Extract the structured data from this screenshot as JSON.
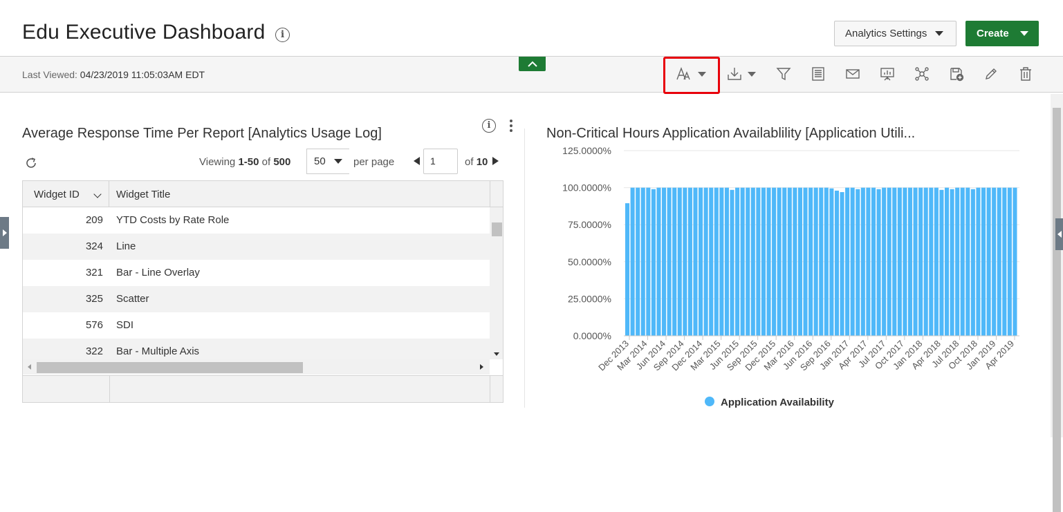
{
  "header": {
    "title": "Edu Executive Dashboard",
    "info_icon": "info-icon",
    "settings_label": "Analytics Settings",
    "create_label": "Create",
    "create_color": "#1e7b34"
  },
  "toolbar": {
    "last_viewed_label": "Last Viewed:",
    "last_viewed_value": "04/23/2019 11:05:03AM EDT",
    "icons": [
      "font-size-icon",
      "download-icon",
      "filter-icon",
      "notes-icon",
      "email-icon",
      "presentation-icon",
      "network-icon",
      "save-as-icon",
      "edit-icon",
      "delete-icon"
    ]
  },
  "left_widget": {
    "title": "Average Response Time Per Report [Analytics Usage Log]",
    "viewing_label": "Viewing",
    "viewing_range": "1-50",
    "of_label": "of",
    "total": "500",
    "page_size": "50",
    "per_page_label": "per page",
    "page_input": "1",
    "page_of_label": "of",
    "page_total": "10",
    "columns": [
      "Widget ID",
      "Widget Title"
    ],
    "rows": [
      {
        "id": "209",
        "title": "YTD Costs by Rate Role"
      },
      {
        "id": "324",
        "title": "Line"
      },
      {
        "id": "321",
        "title": "Bar - Line Overlay"
      },
      {
        "id": "325",
        "title": "Scatter"
      },
      {
        "id": "576",
        "title": "SDI"
      },
      {
        "id": "322",
        "title": "Bar - Multiple Axis"
      }
    ]
  },
  "right_widget": {
    "title": "Non-Critical Hours Application Availablility [Application Utili..."
  },
  "chart_data": {
    "type": "bar",
    "title": "Non-Critical Hours Application Availablility [Application Utili...",
    "color": "#4fb8f9",
    "y_ticks": [
      "0.0000%",
      "25.0000%",
      "50.0000%",
      "75.0000%",
      "100.0000%",
      "125.0000%"
    ],
    "ylim": [
      0,
      125
    ],
    "tick_labels": [
      "Dec 2013",
      "Mar 2014",
      "Jun 2014",
      "Sep 2014",
      "Dec 2014",
      "Mar 2015",
      "Jun 2015",
      "Sep 2015",
      "Dec 2015",
      "Mar 2016",
      "Jun 2016",
      "Sep 2016",
      "Jan 2017",
      "Apr 2017",
      "Jul 2017",
      "Oct 2017",
      "Jan 2018",
      "Apr 2018",
      "Jul 2018",
      "Oct 2018",
      "Jan 2019",
      "Apr 2019"
    ],
    "series": [
      {
        "name": "Application Availability",
        "values": [
          89.5,
          100,
          100,
          100,
          100,
          99,
          100,
          100,
          100,
          100,
          100,
          100,
          100,
          100,
          100,
          100,
          100,
          100,
          100,
          100,
          98.5,
          100,
          100,
          100,
          100,
          100,
          100,
          100,
          100,
          100,
          100,
          100,
          100,
          100,
          100,
          100,
          100,
          100,
          100,
          99.5,
          98,
          97,
          100,
          100,
          99,
          100,
          100,
          100,
          99,
          100,
          100,
          100,
          100,
          100,
          100,
          100,
          100,
          100,
          100,
          100,
          98.5,
          100,
          99,
          100,
          100,
          100,
          99,
          100,
          100,
          100,
          100,
          100,
          100,
          100,
          100
        ]
      }
    ],
    "legend_position": "bottom"
  }
}
